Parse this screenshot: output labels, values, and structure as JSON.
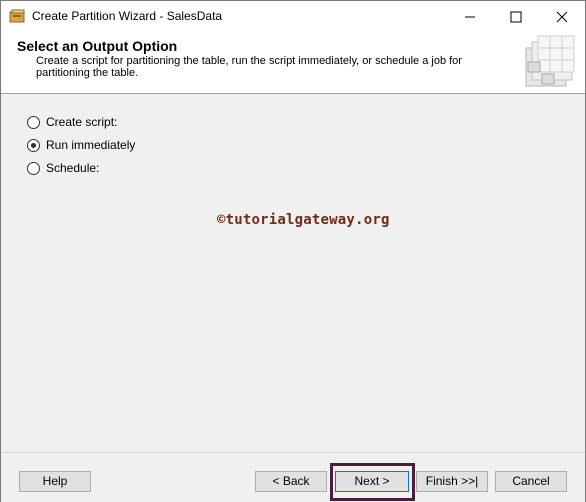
{
  "window": {
    "title": "Create Partition Wizard - SalesData"
  },
  "header": {
    "title": "Select an Output Option",
    "description": "Create a script for partitioning the table, run the script immediately, or schedule a job for partitioning the table."
  },
  "options": [
    {
      "label": "Create script:",
      "selected": false
    },
    {
      "label": "Run immediately",
      "selected": true
    },
    {
      "label": "Schedule:",
      "selected": false
    }
  ],
  "watermark": "©tutorialgateway.org",
  "footer": {
    "help": "Help",
    "back": "< Back",
    "next": "Next >",
    "finish": "Finish >>|",
    "cancel": "Cancel"
  },
  "colors": {
    "highlight_border": "#4b1d3f",
    "watermark": "#6e2b16"
  }
}
